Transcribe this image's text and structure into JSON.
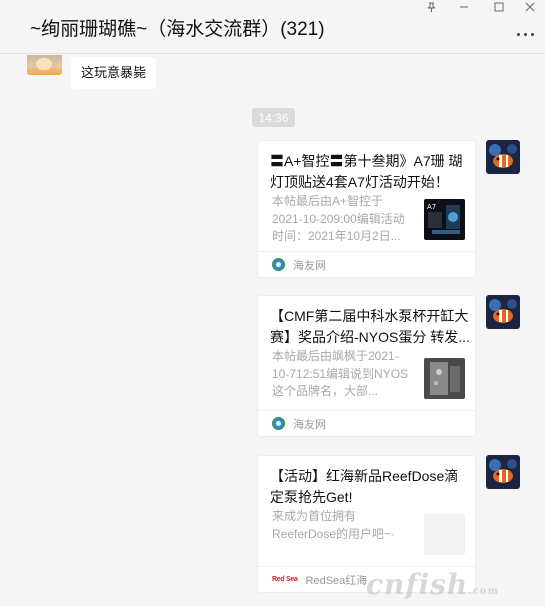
{
  "window": {
    "title": "~绚丽珊瑚礁~（海水交流群）(321)",
    "controls": [
      "pin-icon",
      "minimize-icon",
      "maximize-icon",
      "close-icon"
    ]
  },
  "messages": {
    "left_text": "这玩意暴毙",
    "time": "14:36",
    "cards": [
      {
        "title": "〓A+智控〓第十叁期》A7珊 瑚灯顶贴送4套A7灯活动开始！",
        "desc": "本帖最后由A+智控于2021-10-209:00编辑活动时间：2021年10月2日...",
        "thumb_text": "A7",
        "source": "海友网",
        "source_icon": "haiyouwang-logo-icon"
      },
      {
        "title": "【CMF第二届中科水泵杯开缸大赛】奖品介绍-NYOS蛋分 转发...",
        "desc": "本帖最后由飒枫于2021-10-712:51编辑说到NYOS这个品牌名，大部...",
        "source": "海友网",
        "source_icon": "haiyouwang-logo-icon"
      },
      {
        "title": "【活动】红海新品ReefDose滴定泵抢先Get!",
        "desc": "来成为首位拥有ReeferDose的用户吧~·",
        "source": "RedSea红海",
        "source_icon": "redsea-logo-icon",
        "source_logo_text": "Red Sea"
      }
    ]
  },
  "watermark": {
    "main": "cnfish",
    "suffix": ".com"
  },
  "colors": {
    "bg": "#f5f5f5",
    "time_badge": "#dadada",
    "card": "#ffffff",
    "muted": "#a8a8a8"
  }
}
